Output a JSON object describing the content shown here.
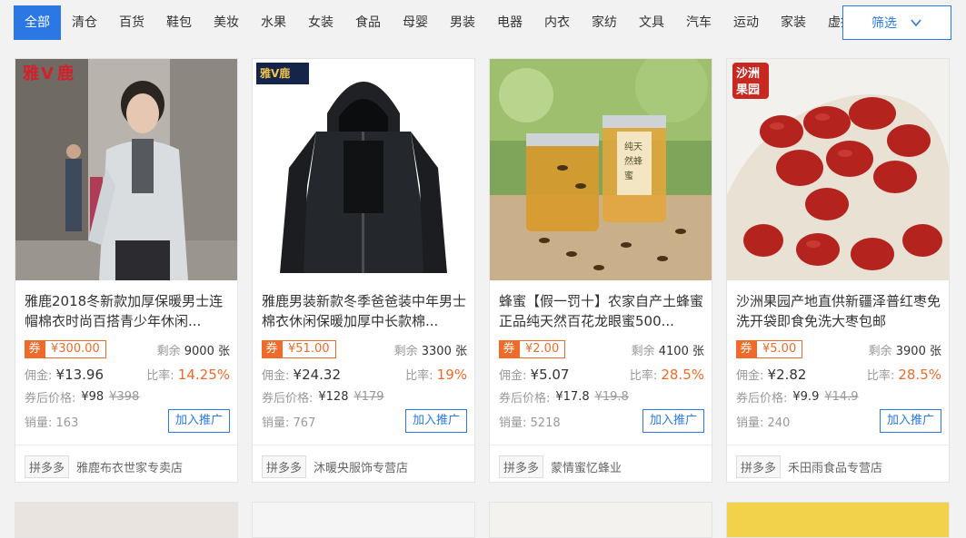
{
  "categories": [
    "全部",
    "清仓",
    "百货",
    "鞋包",
    "美妆",
    "水果",
    "女装",
    "食品",
    "母婴",
    "男装",
    "电器",
    "内衣",
    "家纺",
    "文具",
    "汽车",
    "运动",
    "家装",
    "虚拟"
  ],
  "filter_label": "筛选",
  "labels": {
    "remaining_prefix": "剩余",
    "remaining_suffix": "张",
    "commission": "佣金:",
    "rate": "比率:",
    "after_coupon": "券后价格:",
    "sales": "销量:",
    "promote": "加入推广",
    "coupon_tag": "券"
  },
  "products": [
    {
      "title": "雅鹿2018冬新款加厚保暖男士连帽棉衣时尚百搭青少年休闲...",
      "coupon": "¥300.00",
      "remaining": "9000",
      "commission": "¥13.96",
      "rate": "14.25%",
      "price": "¥98",
      "orig_price": "¥398",
      "sales": "163",
      "platform": "拼多多",
      "shop": "雅鹿布衣世家专卖店",
      "brand": "雅鹿"
    },
    {
      "title": "雅鹿男装新款冬季爸爸装中年男士棉衣休闲保暖加厚中长款棉...",
      "coupon": "¥51.00",
      "remaining": "3300",
      "commission": "¥24.32",
      "rate": "19%",
      "price": "¥128",
      "orig_price": "¥179",
      "sales": "767",
      "platform": "拼多多",
      "shop": "沐暖央服饰专营店",
      "brand": "雅鹿"
    },
    {
      "title": "蜂蜜【假一罚十】农家自产土蜂蜜正品纯天然百花龙眼蜜500...",
      "coupon": "¥2.00",
      "remaining": "4100",
      "commission": "¥5.07",
      "rate": "28.5%",
      "price": "¥17.8",
      "orig_price": "¥19.8",
      "sales": "5218",
      "platform": "拼多多",
      "shop": "蒙情蜜忆蜂业",
      "brand": "纯天然蜂蜜"
    },
    {
      "title": "沙洲果园产地直供新疆泽普红枣免洗开袋即食免洗大枣包邮",
      "coupon": "¥5.00",
      "remaining": "3900",
      "commission": "¥2.82",
      "rate": "28.5%",
      "price": "¥9.9",
      "orig_price": "¥14.9",
      "sales": "240",
      "platform": "拼多多",
      "shop": "禾田雨食品专营店",
      "brand": "沙洲果园"
    }
  ],
  "colors": {
    "accent": "#2b78e4",
    "orange": "#f06a2a"
  }
}
